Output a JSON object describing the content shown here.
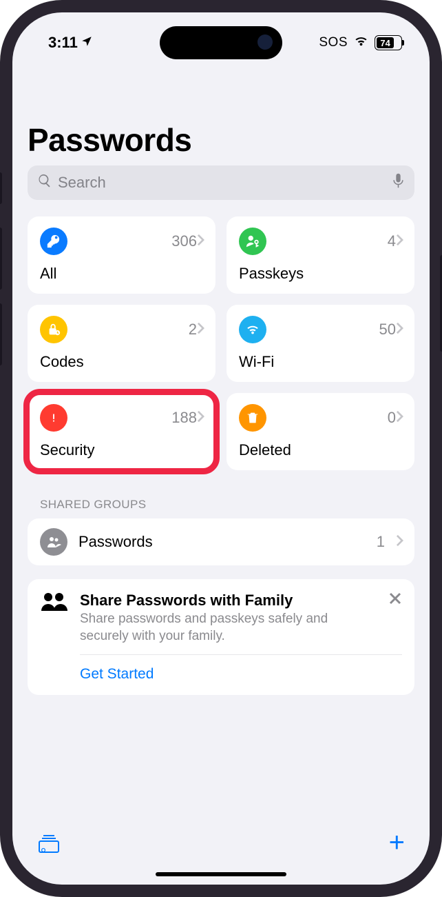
{
  "status": {
    "time": "3:11",
    "sos": "SOS",
    "battery_pct": "74"
  },
  "page": {
    "title": "Passwords",
    "search_placeholder": "Search"
  },
  "cards": {
    "all": {
      "label": "All",
      "count": "306"
    },
    "passkeys": {
      "label": "Passkeys",
      "count": "4"
    },
    "codes": {
      "label": "Codes",
      "count": "2"
    },
    "wifi": {
      "label": "Wi-Fi",
      "count": "50"
    },
    "security": {
      "label": "Security",
      "count": "188"
    },
    "deleted": {
      "label": "Deleted",
      "count": "0"
    }
  },
  "shared": {
    "header": "SHARED GROUPS",
    "row_label": "Passwords",
    "row_count": "1"
  },
  "promo": {
    "title": "Share Passwords with Family",
    "subtitle": "Share passwords and passkeys safely and securely with your family.",
    "action": "Get Started"
  }
}
